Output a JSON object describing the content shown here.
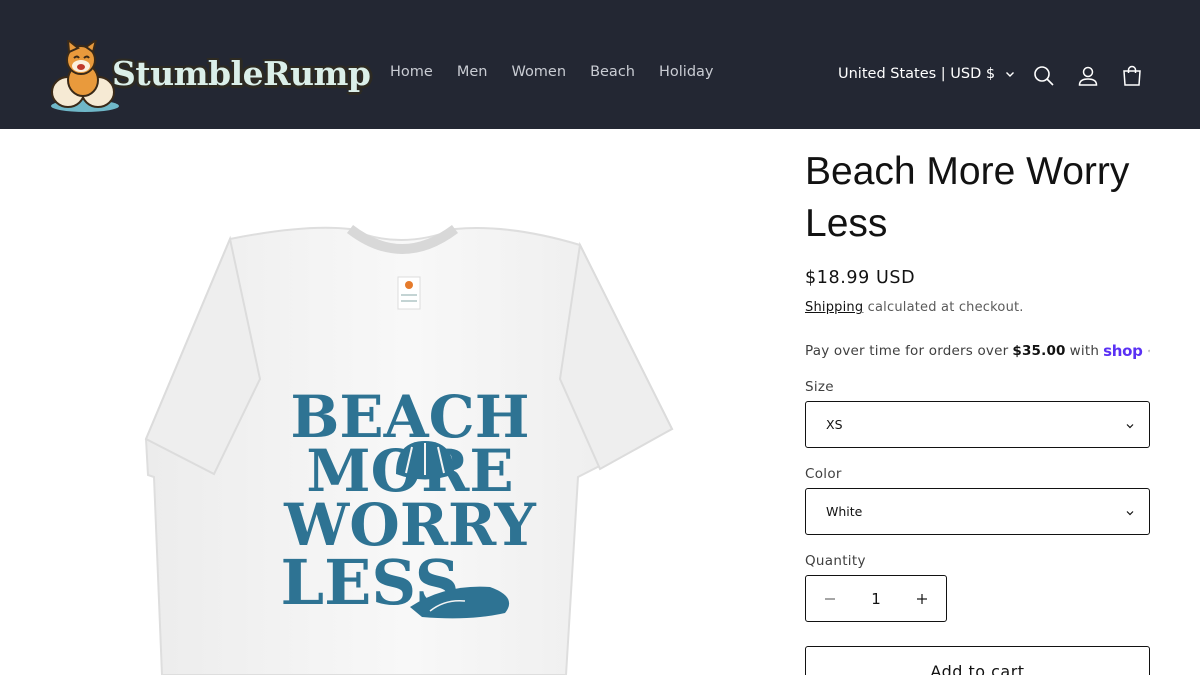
{
  "brand": {
    "name": "StumbleRump"
  },
  "nav": {
    "items": [
      {
        "label": "Home"
      },
      {
        "label": "Men"
      },
      {
        "label": "Women"
      },
      {
        "label": "Beach"
      },
      {
        "label": "Holiday"
      }
    ]
  },
  "header": {
    "locale_label": "United States | USD $",
    "icons": [
      "search-icon",
      "account-icon",
      "cart-icon"
    ]
  },
  "product": {
    "title": "Beach More Worry Less",
    "price": "$18.99 USD",
    "shipping_link": "Shipping",
    "shipping_text": "calculated at checkout.",
    "installments_prefix": "Pay over time for orders over",
    "installments_amount": "$35.00",
    "installments_suffix": "with",
    "installments_brand": "shop",
    "shirt_print": {
      "line1": "BEACH",
      "line2": "MORE",
      "line3": "WORRY",
      "line4": "LESS"
    }
  },
  "options": {
    "size_label": "Size",
    "size_value": "XS",
    "color_label": "Color",
    "color_value": "White",
    "quantity_label": "Quantity",
    "quantity_value": "1"
  },
  "actions": {
    "add_to_cart": "Add to cart"
  },
  "colors": {
    "header_bg": "#232733",
    "print_teal": "#2e7393",
    "shop_purple": "#5a31f4"
  }
}
